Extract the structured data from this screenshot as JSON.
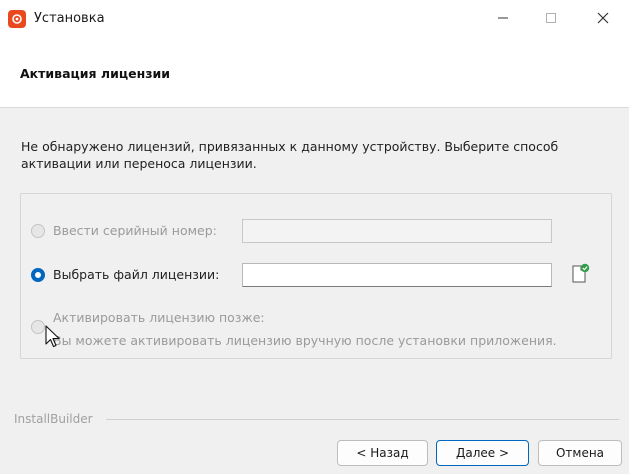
{
  "window": {
    "title": "Установка",
    "minimize_glyph": "—",
    "maximize_glyph": "□",
    "close_glyph": "✕"
  },
  "header": {
    "title": "Активация лицензии"
  },
  "content": {
    "description": "Не обнаружено лицензий, привязанных к данному устройству. Выберите способ активации или переноса лицензии.",
    "options": {
      "serial": {
        "label": "Ввести серийный номер:",
        "value": "",
        "selected": false,
        "enabled": false
      },
      "file": {
        "label": "Выбрать файл лицензии:",
        "value": "",
        "selected": true,
        "enabled": true
      },
      "later": {
        "label": "Активировать лицензию позже:",
        "note": "Вы можете активировать лицензию вручную после установки приложения.",
        "selected": false,
        "enabled": false
      }
    }
  },
  "footer": {
    "brand": "InstallBuilder",
    "back_label": "< Назад",
    "next_label": "Далее >",
    "cancel_label": "Отмена"
  },
  "colors": {
    "accent": "#0067c0",
    "app_icon": "#e8491f",
    "browse_badge": "#2e9e4a"
  },
  "icons": {
    "app": "app-logo-icon",
    "browse": "browse-file-icon",
    "cursor": "mouse-pointer-icon"
  }
}
